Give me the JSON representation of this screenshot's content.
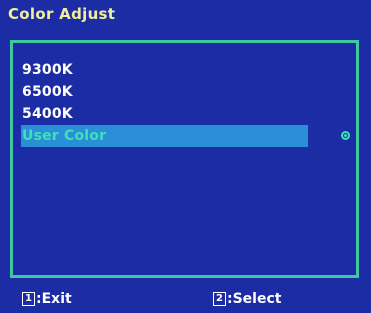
{
  "title": "Color Adjust",
  "menu": {
    "items": [
      {
        "label": "9300K"
      },
      {
        "label": "6500K"
      },
      {
        "label": "5400K"
      },
      {
        "label": "User Color"
      }
    ],
    "selected_index": 3
  },
  "footer": {
    "exit": {
      "key": "1",
      "label": ":Exit"
    },
    "select": {
      "key": "2",
      "label": ":Select"
    }
  },
  "colors": {
    "background": "#1c2ca4",
    "frame": "#3fc7a0",
    "title": "#f2ee9a",
    "highlight": "#2a8fd6",
    "highlight_text": "#3de2b6"
  }
}
